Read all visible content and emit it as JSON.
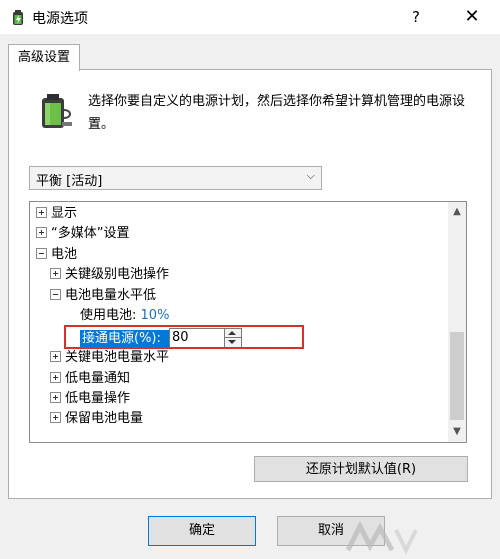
{
  "window": {
    "title": "电源选项",
    "help_label": "?",
    "close_label": "✕"
  },
  "tab": {
    "label": "高级设置"
  },
  "description": "选择你要自定义的电源计划，然后选择你希望计算机管理的电源设置。",
  "plan_select": {
    "value": "平衡 [活动]"
  },
  "tree": {
    "items": [
      {
        "label": "显示",
        "state": "collapsed"
      },
      {
        "label": "“多媒体”设置",
        "state": "collapsed"
      },
      {
        "label": "电池",
        "state": "expanded"
      },
      {
        "label": "关键级别电池操作",
        "state": "collapsed"
      },
      {
        "label": "电池电量水平低",
        "state": "expanded"
      },
      {
        "label": "使用电池:",
        "value": "10%"
      },
      {
        "label": "接通电源(%):",
        "value": "80"
      },
      {
        "label": "关键电池电量水平",
        "state": "collapsed"
      },
      {
        "label": "低电量通知",
        "state": "collapsed"
      },
      {
        "label": "低电量操作",
        "state": "collapsed"
      },
      {
        "label": "保留电池电量",
        "state": "collapsed"
      }
    ]
  },
  "buttons": {
    "restore": "还原计划默认值(R)",
    "ok": "确定",
    "cancel": "取消"
  },
  "colors": {
    "accent": "#0078d7",
    "highlight_box": "#d9302b",
    "value_text": "#1f6fbf"
  }
}
